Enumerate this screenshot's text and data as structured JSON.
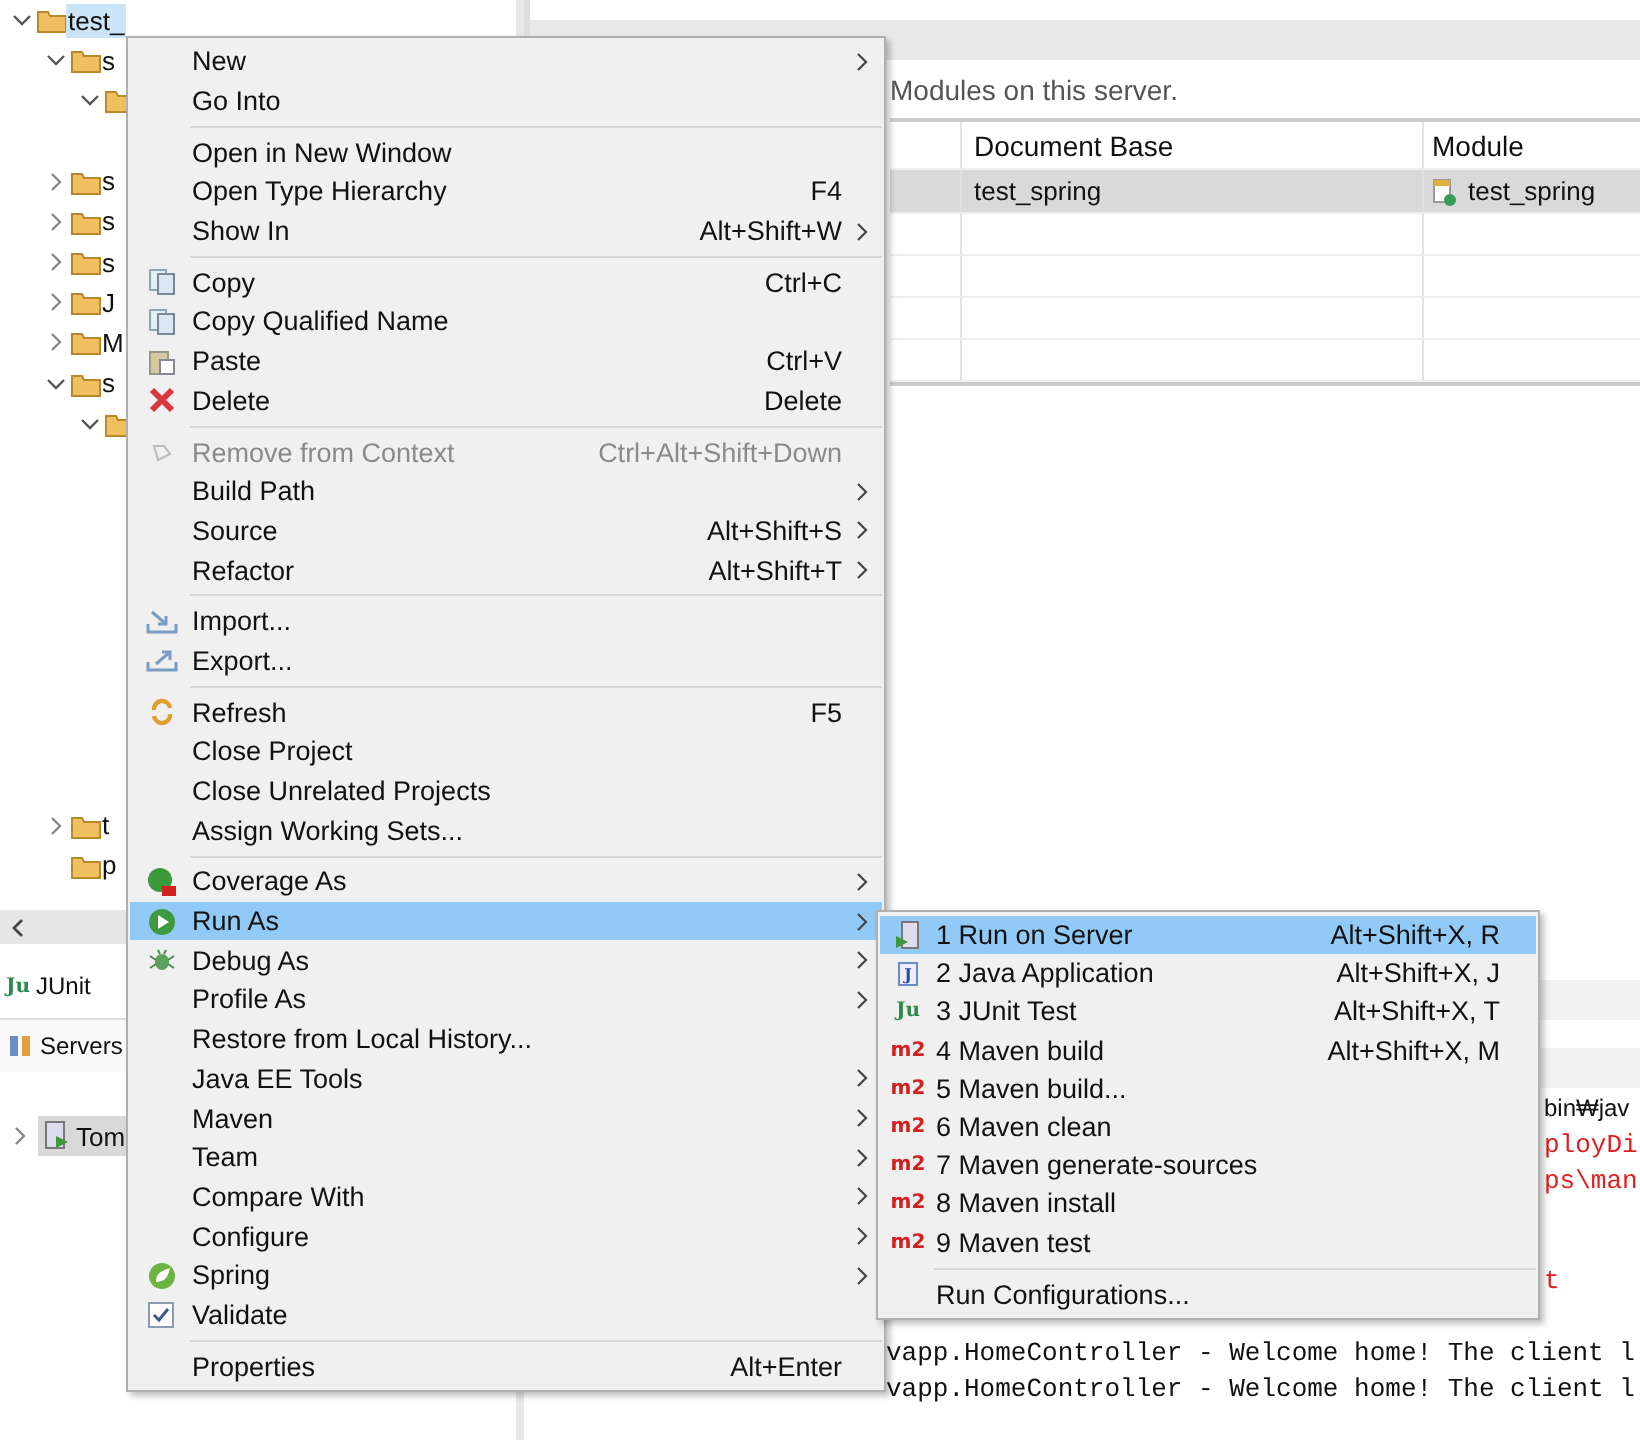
{
  "explorer": {
    "tree": [
      {
        "label": "test_",
        "selected": true,
        "expanded": true,
        "children": [
          {
            "label": "s",
            "selected": false,
            "expanded": true,
            "children": [
              {
                "expanded": true
              }
            ]
          },
          {
            "label": "s",
            "selected": false,
            "expanded": false
          },
          {
            "label": "s",
            "selected": false,
            "expanded": false
          },
          {
            "label": "s",
            "selected": false,
            "expanded": false
          },
          {
            "label": "J",
            "selected": false,
            "expanded": false
          },
          {
            "label": "M",
            "selected": false,
            "expanded": false
          },
          {
            "label": "s",
            "selected": false,
            "expanded": true,
            "children": [
              {
                "expanded": true
              }
            ]
          },
          {
            "label": "t",
            "selected": false,
            "expanded": false
          },
          {
            "label": "p",
            "selected": false
          }
        ]
      }
    ]
  },
  "bottom_left": {
    "tabs": [
      {
        "label": "JUnit",
        "badge": "Ju",
        "selected": false
      },
      {
        "label": "Servers",
        "selected": true
      }
    ],
    "servers": [
      {
        "label": "Tom",
        "selected": true,
        "expanded": false
      }
    ]
  },
  "server_editor": {
    "description": "Modules on this server.",
    "columns": [
      "Document Base",
      "Module"
    ],
    "rows": [
      {
        "document_base": "test_spring",
        "module": "test_spring",
        "selected": true
      }
    ]
  },
  "console": {
    "lines": [
      {
        "kind": "header",
        "text": "bin₩jav",
        "error": false
      },
      {
        "kind": "tail",
        "text": "ployDi",
        "error": true
      },
      {
        "kind": "tail",
        "text": "ps\\man",
        "error": true
      },
      {
        "kind": "tail",
        "text": "t",
        "error": true
      },
      {
        "kind": "full",
        "text": "vapp.HomeController - Welcome home! The client l",
        "error": false
      },
      {
        "kind": "full",
        "text": "vapp.HomeController - Welcome home! The client l",
        "error": false
      }
    ]
  },
  "context_menu": {
    "groups": [
      [
        {
          "label": "New",
          "submenu": true,
          "selected": false
        },
        {
          "label": "Go Into",
          "selected": false
        }
      ],
      [
        {
          "label": "Open in New Window",
          "selected": false
        },
        {
          "label": "Open Type Hierarchy",
          "shortcut": "F4",
          "selected": false
        },
        {
          "label": "Show In",
          "shortcut": "Alt+Shift+W",
          "submenu": true,
          "selected": false
        }
      ],
      [
        {
          "label": "Copy",
          "shortcut": "Ctrl+C",
          "selected": false
        },
        {
          "label": "Copy Qualified Name",
          "selected": false
        },
        {
          "label": "Paste",
          "shortcut": "Ctrl+V",
          "selected": false
        },
        {
          "label": "Delete",
          "shortcut": "Delete",
          "selected": false
        }
      ],
      [
        {
          "label": "Remove from Context",
          "shortcut": "Ctrl+Alt+Shift+Down",
          "disabled": true,
          "selected": false
        },
        {
          "label": "Build Path",
          "submenu": true,
          "selected": false
        },
        {
          "label": "Source",
          "shortcut": "Alt+Shift+S",
          "submenu": true,
          "selected": false
        },
        {
          "label": "Refactor",
          "shortcut": "Alt+Shift+T",
          "submenu": true,
          "selected": false
        }
      ],
      [
        {
          "label": "Import...",
          "selected": false
        },
        {
          "label": "Export...",
          "selected": false
        }
      ],
      [
        {
          "label": "Refresh",
          "shortcut": "F5",
          "selected": false
        },
        {
          "label": "Close Project",
          "selected": false
        },
        {
          "label": "Close Unrelated Projects",
          "selected": false
        },
        {
          "label": "Assign Working Sets...",
          "selected": false
        }
      ],
      [
        {
          "label": "Coverage As",
          "submenu": true,
          "selected": false
        },
        {
          "label": "Run As",
          "submenu": true,
          "selected": true
        },
        {
          "label": "Debug As",
          "submenu": true,
          "selected": false
        },
        {
          "label": "Profile As",
          "submenu": true,
          "selected": false
        },
        {
          "label": "Restore from Local History...",
          "selected": false
        },
        {
          "label": "Java EE Tools",
          "submenu": true,
          "selected": false
        },
        {
          "label": "Maven",
          "submenu": true,
          "selected": false
        },
        {
          "label": "Team",
          "submenu": true,
          "selected": false
        },
        {
          "label": "Compare With",
          "submenu": true,
          "selected": false
        },
        {
          "label": "Configure",
          "submenu": true,
          "selected": false
        },
        {
          "label": "Spring",
          "submenu": true,
          "selected": false
        },
        {
          "label": "Validate",
          "selected": false
        }
      ],
      [
        {
          "label": "Properties",
          "shortcut": "Alt+Enter",
          "selected": false
        }
      ]
    ]
  },
  "run_as_menu": {
    "groups": [
      [
        {
          "label": "1 Run on Server",
          "shortcut": "Alt+Shift+X, R",
          "selected": true
        },
        {
          "label": "2 Java Application",
          "shortcut": "Alt+Shift+X, J",
          "badge": "J",
          "selected": false
        },
        {
          "label": "3 JUnit Test",
          "shortcut": "Alt+Shift+X, T",
          "badge": "Ju",
          "selected": false
        },
        {
          "label": "4 Maven build",
          "shortcut": "Alt+Shift+X, M",
          "badge": "m2",
          "selected": false
        },
        {
          "label": "5 Maven build...",
          "badge": "m2",
          "selected": false
        },
        {
          "label": "6 Maven clean",
          "badge": "m2",
          "selected": false
        },
        {
          "label": "7 Maven generate-sources",
          "badge": "m2",
          "selected": false
        },
        {
          "label": "8 Maven install",
          "badge": "m2",
          "selected": false
        },
        {
          "label": "9 Maven test",
          "badge": "m2",
          "selected": false
        }
      ],
      [
        {
          "label": "Run Configurations...",
          "selected": false
        }
      ]
    ]
  }
}
